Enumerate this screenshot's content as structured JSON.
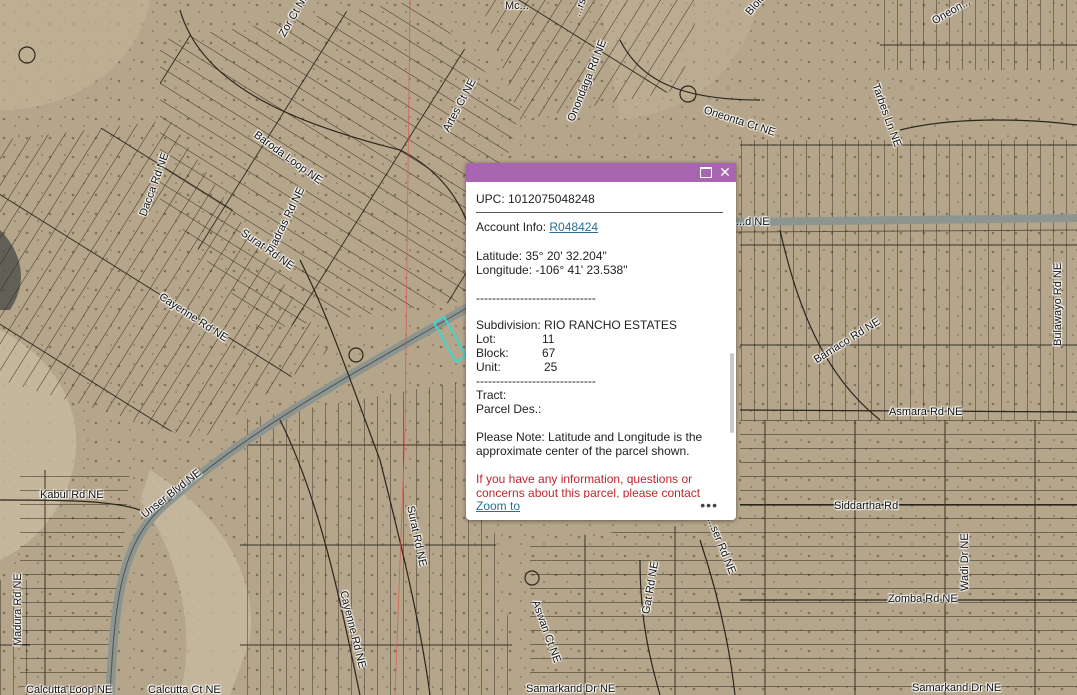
{
  "map": {
    "labels": [
      {
        "text": "Zor Ct NE"
      },
      {
        "text": "Mc..."
      },
      {
        "text": "...rs Rd NE"
      },
      {
        "text": "Blois"
      },
      {
        "text": "Oneon..."
      },
      {
        "text": "Onondaga Rd NE"
      },
      {
        "text": "Artes Ct NE"
      },
      {
        "text": "Oneonta Ct NE"
      },
      {
        "text": "Tarbes Ln NE"
      },
      {
        "text": "Baroda Loop NE"
      },
      {
        "text": "Dacca Rd NE"
      },
      {
        "text": "Madras Rd NE"
      },
      {
        "text": "Surat Rd NE"
      },
      {
        "text": "Cayenne Rd NE"
      },
      {
        "text": "...d NE"
      },
      {
        "text": "Bulawayo Rd NE"
      },
      {
        "text": "Bamaco Rd NE"
      },
      {
        "text": "Asmara Rd NE"
      },
      {
        "text": "Unser Blvd NE"
      },
      {
        "text": "Kabul Rd NE"
      },
      {
        "text": "Siddartha Rd"
      },
      {
        "text": "...ser Rd NE"
      },
      {
        "text": "Surat Rd NE"
      },
      {
        "text": "Wadi Dr NE"
      },
      {
        "text": "Gat Rd NE"
      },
      {
        "text": "Aswan Ct NE"
      },
      {
        "text": "Zomba Rd NE"
      },
      {
        "text": "Cayenne Rd NE"
      },
      {
        "text": "Madura Rd NE"
      },
      {
        "text": "Samarkand Dr NE"
      },
      {
        "text": "Samarkand Dr NE"
      },
      {
        "text": "Calcutta Ct NE"
      },
      {
        "text": "Calcutta Loop NE"
      }
    ]
  },
  "popup": {
    "upc": "UPC: 1012075048248",
    "account_label": "Account Info:",
    "account_link": "R048424",
    "latitude": "Latitude: 35° 20' 32.204\"",
    "longitude": "Longitude: -106° 41' 23.538\"",
    "separator": "------------------------------",
    "subdivision": "Subdivision: RIO RANCHO ESTATES",
    "lot_label": "Lot:",
    "lot_value": "11",
    "block_label": "Block:",
    "block_value": "67",
    "unit_label": "Unit:",
    "unit_value": "25",
    "separator2": "------------------------------",
    "tract_label": "Tract:",
    "parcel_des_label": "Parcel Des.:",
    "note_line1": "Please Note: Latitude and Longitude is the",
    "note_line2": "approximate center of the parcel shown.",
    "contact_line1": "If you have any information, questions or",
    "contact_line2": "concerns about this parcel, please contact",
    "zoom_to": "Zoom to",
    "more": "•••",
    "header_color": "#a966b0",
    "link_color": "#2a6f93",
    "warning_color": "#c0262c"
  },
  "colors": {
    "terrain": "#b5a58a",
    "parcel_lines": "#2b261e",
    "road": "#8d9590",
    "highlight": "#3fd6d0"
  }
}
